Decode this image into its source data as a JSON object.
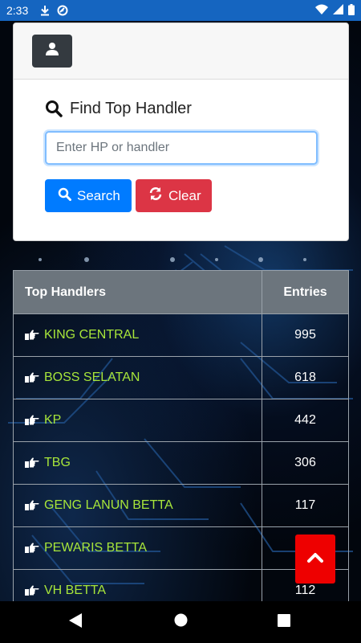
{
  "status_bar": {
    "time": "2:33",
    "icons_left": [
      "download-icon",
      "sync-icon"
    ],
    "icons_right": [
      "wifi-icon",
      "signal-icon",
      "battery-icon"
    ],
    "color": "#1565c0"
  },
  "profile_button": {
    "icon": "user-icon"
  },
  "finder": {
    "title": "Find Top Handler",
    "title_icon": "search-icon",
    "input_placeholder": "Enter HP or handler",
    "input_value": "",
    "search_label": "Search",
    "clear_label": "Clear"
  },
  "table": {
    "headers": {
      "handlers": "Top Handlers",
      "entries": "Entries"
    },
    "rows": [
      {
        "name": "KING CENTRAL",
        "entries": "995"
      },
      {
        "name": "BOSS SELATAN",
        "entries": "618"
      },
      {
        "name": "KP",
        "entries": "442"
      },
      {
        "name": "TBG",
        "entries": "306"
      },
      {
        "name": "GENG LANUN BETTA",
        "entries": "117"
      },
      {
        "name": "PEWARIS BETTA",
        "entries": ""
      },
      {
        "name": "VH BETTA",
        "entries": "112"
      }
    ],
    "row_icon": "hand-pointing-right-icon",
    "name_color": "#a8e63a"
  },
  "scroll_top": {
    "icon": "chevron-up-icon",
    "color": "#ee0000"
  },
  "nav_bar": {
    "icons": [
      "back-icon",
      "home-icon",
      "recents-icon"
    ]
  }
}
